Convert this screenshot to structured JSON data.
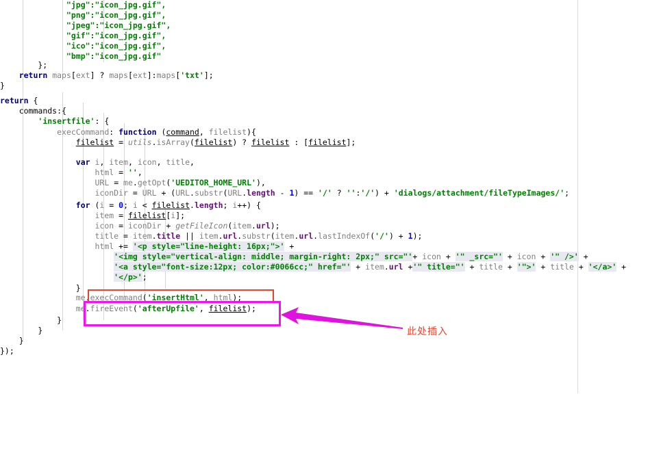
{
  "editor": {
    "language": "javascript",
    "background_color": "#ffffff",
    "font_size_px": 11.5,
    "line_height_px": 15
  },
  "colors": {
    "keyword": "#000080",
    "string": "#008000",
    "number": "#0000ff",
    "property": "#660e7a",
    "identifier": "#000000",
    "guide_line": "#d6d6d6",
    "annotation_red": "#e8442c",
    "annotation_magenta": "#f012f0",
    "note_text": "#e8442c"
  },
  "code_lines": [
    {
      "id": "l01",
      "indent": 0,
      "text": "              \"jpg\":\"icon_jpg.gif\","
    },
    {
      "id": "l02",
      "indent": 0,
      "text": "              \"png\":\"icon_jpg.gif\","
    },
    {
      "id": "l03",
      "indent": 0,
      "text": "              \"jpeg\":\"icon_jpg.gif\","
    },
    {
      "id": "l04",
      "indent": 0,
      "text": "              \"gif\":\"icon_jpg.gif\","
    },
    {
      "id": "l05",
      "indent": 0,
      "text": "              \"ico\":\"icon_jpg.gif\","
    },
    {
      "id": "l06",
      "indent": 0,
      "text": "              \"bmp\":\"icon_jpg.gif\""
    },
    {
      "id": "l07",
      "indent": 0,
      "text": "        };"
    },
    {
      "id": "l08",
      "indent": 0,
      "text": "    return maps[ext] ? maps[ext]:maps['txt'];"
    },
    {
      "id": "l09",
      "indent": 0,
      "text": "}"
    },
    {
      "id": "l10",
      "indent": 0,
      "text": ""
    },
    {
      "id": "l11",
      "indent": 0,
      "text": "return {"
    },
    {
      "id": "l12",
      "indent": 0,
      "text": "    commands:{"
    },
    {
      "id": "l13",
      "indent": 0,
      "text": "        'insertfile': {"
    },
    {
      "id": "l14",
      "indent": 0,
      "text": "            execCommand: function (command, filelist){"
    },
    {
      "id": "l15",
      "indent": 0,
      "text": "                filelist = utils.isArray(filelist) ? filelist : [filelist];"
    },
    {
      "id": "l16",
      "indent": 0,
      "text": ""
    },
    {
      "id": "l17",
      "indent": 0,
      "text": "                var i, item, icon, title,"
    },
    {
      "id": "l18",
      "indent": 0,
      "text": "                    html = '',"
    },
    {
      "id": "l19",
      "indent": 0,
      "text": "                    URL = me.getOpt('UEDITOR_HOME_URL'),"
    },
    {
      "id": "l20",
      "indent": 0,
      "text": "                    iconDir = URL + (URL.substr(URL.length - 1) == '/' ? '':'/') + 'dialogs/attachment/fileTypeImages/';"
    },
    {
      "id": "l21",
      "indent": 0,
      "text": "                for (i = 0; i < filelist.length; i++) {"
    },
    {
      "id": "l22",
      "indent": 0,
      "text": "                    item = filelist[i];"
    },
    {
      "id": "l23",
      "indent": 0,
      "text": "                    icon = iconDir + getFileIcon(item.url);"
    },
    {
      "id": "l24",
      "indent": 0,
      "text": "                    title = item.title || item.url.substr(item.url.lastIndexOf('/') + 1);"
    },
    {
      "id": "l25",
      "indent": 0,
      "text": "                    html += '<p style=\"line-height: 16px;\">' +"
    },
    {
      "id": "l26",
      "indent": 0,
      "text": "                        '<img style=\"vertical-align: middle; margin-right: 2px;\" src=\"'+ icon + '\" _src=\"' + icon + '\" />' +"
    },
    {
      "id": "l27",
      "indent": 0,
      "text": "                        '<a style=\"font-size:12px; color:#0066cc;\" href=\"' + item.url +'\" title=\"' + title + '\">' + title + '</a>' +"
    },
    {
      "id": "l28",
      "indent": 0,
      "text": "                        '</p>';"
    },
    {
      "id": "l29",
      "indent": 0,
      "text": "                }"
    },
    {
      "id": "l30",
      "indent": 0,
      "text": "                me.execCommand('insertHtml', html);"
    },
    {
      "id": "l31",
      "indent": 0,
      "text": "                me.fireEvent('afterUpfile', filelist);"
    },
    {
      "id": "l32",
      "indent": 0,
      "text": "            }"
    },
    {
      "id": "l33",
      "indent": 0,
      "text": "        }"
    },
    {
      "id": "l34",
      "indent": 0,
      "text": "    }"
    },
    {
      "id": "l35",
      "indent": 0,
      "text": "});"
    }
  ],
  "annotations": {
    "red_box": {
      "label": "me.execCommand('insertHtml', html);",
      "color": "#e8442c"
    },
    "magenta_box": {
      "label": "me.fireEvent('afterUpfile', filelist);",
      "color": "#f012f0"
    },
    "arrow": {
      "name": "pointer-arrow",
      "direction": "left",
      "color": "#e012e0"
    },
    "note": {
      "text": "此处插入",
      "color": "#e8442c"
    }
  }
}
